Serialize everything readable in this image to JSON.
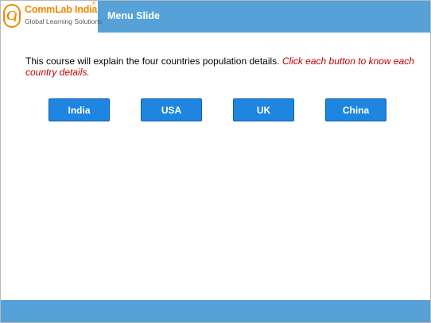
{
  "logo": {
    "brand": "CommLab India",
    "registered_mark": "®",
    "tagline": "Global Learning Solutions",
    "brand_color": "#f08a00"
  },
  "header": {
    "title": "Menu Slide",
    "color": "#56a2d8"
  },
  "intro": {
    "text": "This course will explain the four countries population details. ",
    "hint": "Click each button to know each country details.",
    "hint_color": "#c00000"
  },
  "buttons": [
    {
      "label": "India"
    },
    {
      "label": "USA"
    },
    {
      "label": "UK"
    },
    {
      "label": "China"
    }
  ],
  "button_color": "#1e86e0",
  "footer_color": "#56a2d8"
}
